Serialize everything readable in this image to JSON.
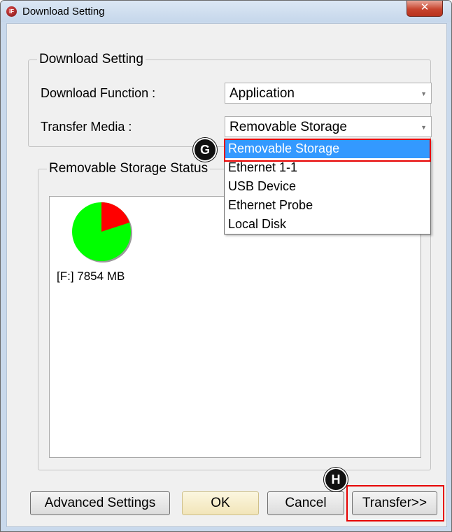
{
  "window": {
    "title": "Download Setting",
    "app_icon_text": "iF",
    "close_glyph": "✕"
  },
  "download_group": {
    "legend": "Download Setting",
    "function_label": "Download Function :",
    "function_value": "Application",
    "media_label": "Transfer Media :",
    "media_value": "Removable Storage"
  },
  "storage_group": {
    "legend": "Removable Storage Status",
    "drive_label": "[F:] 7854 MB",
    "used_fraction": 0.2,
    "free_color": "#00ff00",
    "used_color": "#ff0000"
  },
  "dropdown": {
    "items": [
      "Removable Storage",
      "Ethernet 1-1",
      "USB Device",
      "Ethernet Probe",
      "Local Disk"
    ],
    "selected_index": 0
  },
  "markers": {
    "g": "G",
    "h": "H"
  },
  "buttons": {
    "advanced": "Advanced Settings",
    "ok": "OK",
    "cancel": "Cancel",
    "transfer": "Transfer>>"
  },
  "colors": {
    "highlight_box": "#e60000",
    "selection": "#3399ff"
  },
  "icons": [
    "app-icon",
    "close-icon",
    "chevron-down-icon"
  ]
}
